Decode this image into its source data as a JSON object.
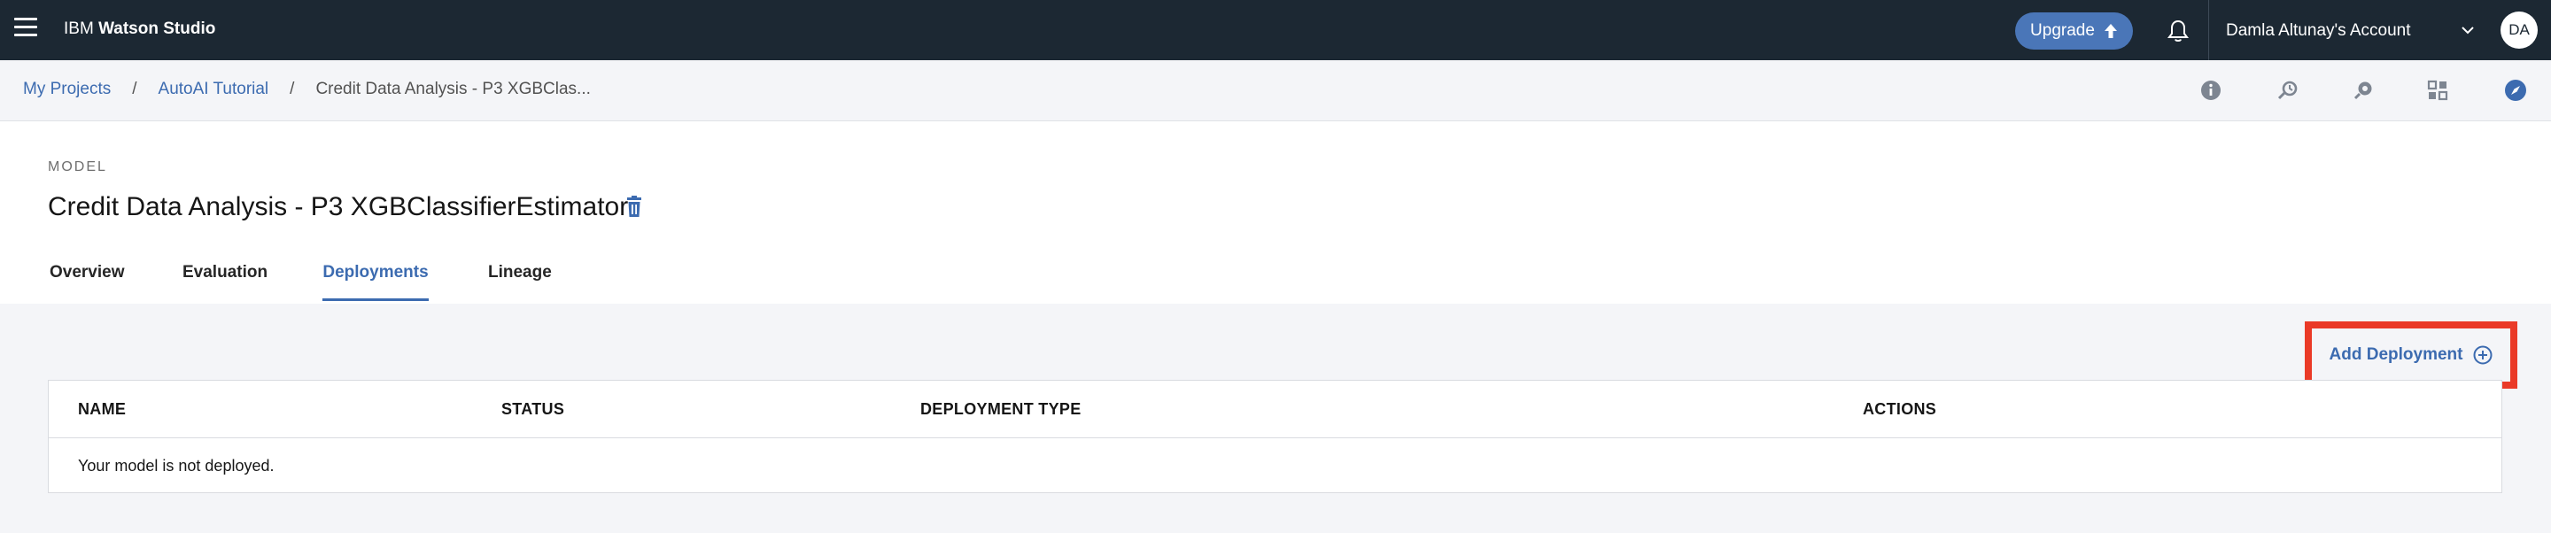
{
  "topbar": {
    "brand_prefix": "IBM",
    "brand_name": "Watson Studio",
    "upgrade_label": "Upgrade",
    "account_label": "Damla Altunay's Account",
    "avatar_initials": "DA"
  },
  "breadcrumb": {
    "items": [
      "My Projects",
      "AutoAI Tutorial"
    ],
    "separator": "/",
    "current": "Credit Data Analysis - P3 XGBClas..."
  },
  "toolbar_icons": [
    "info-icon",
    "history-icon",
    "data-icon",
    "grid-icon",
    "compass-icon"
  ],
  "header": {
    "eyebrow": "MODEL",
    "title": "Credit Data Analysis - P3 XGBClassifierEstimator"
  },
  "tabs": [
    {
      "label": "Overview",
      "active": false
    },
    {
      "label": "Evaluation",
      "active": false
    },
    {
      "label": "Deployments",
      "active": true
    },
    {
      "label": "Lineage",
      "active": false
    }
  ],
  "actions": {
    "add_deployment_label": "Add Deployment"
  },
  "table": {
    "columns": [
      "NAME",
      "STATUS",
      "DEPLOYMENT TYPE",
      "ACTIONS"
    ],
    "empty_message": "Your model is not deployed."
  },
  "colors": {
    "topbar_bg": "#1c2833",
    "accent": "#3c6bb0",
    "upgrade_bg": "#4a76b8",
    "highlight": "#ea3a27"
  }
}
